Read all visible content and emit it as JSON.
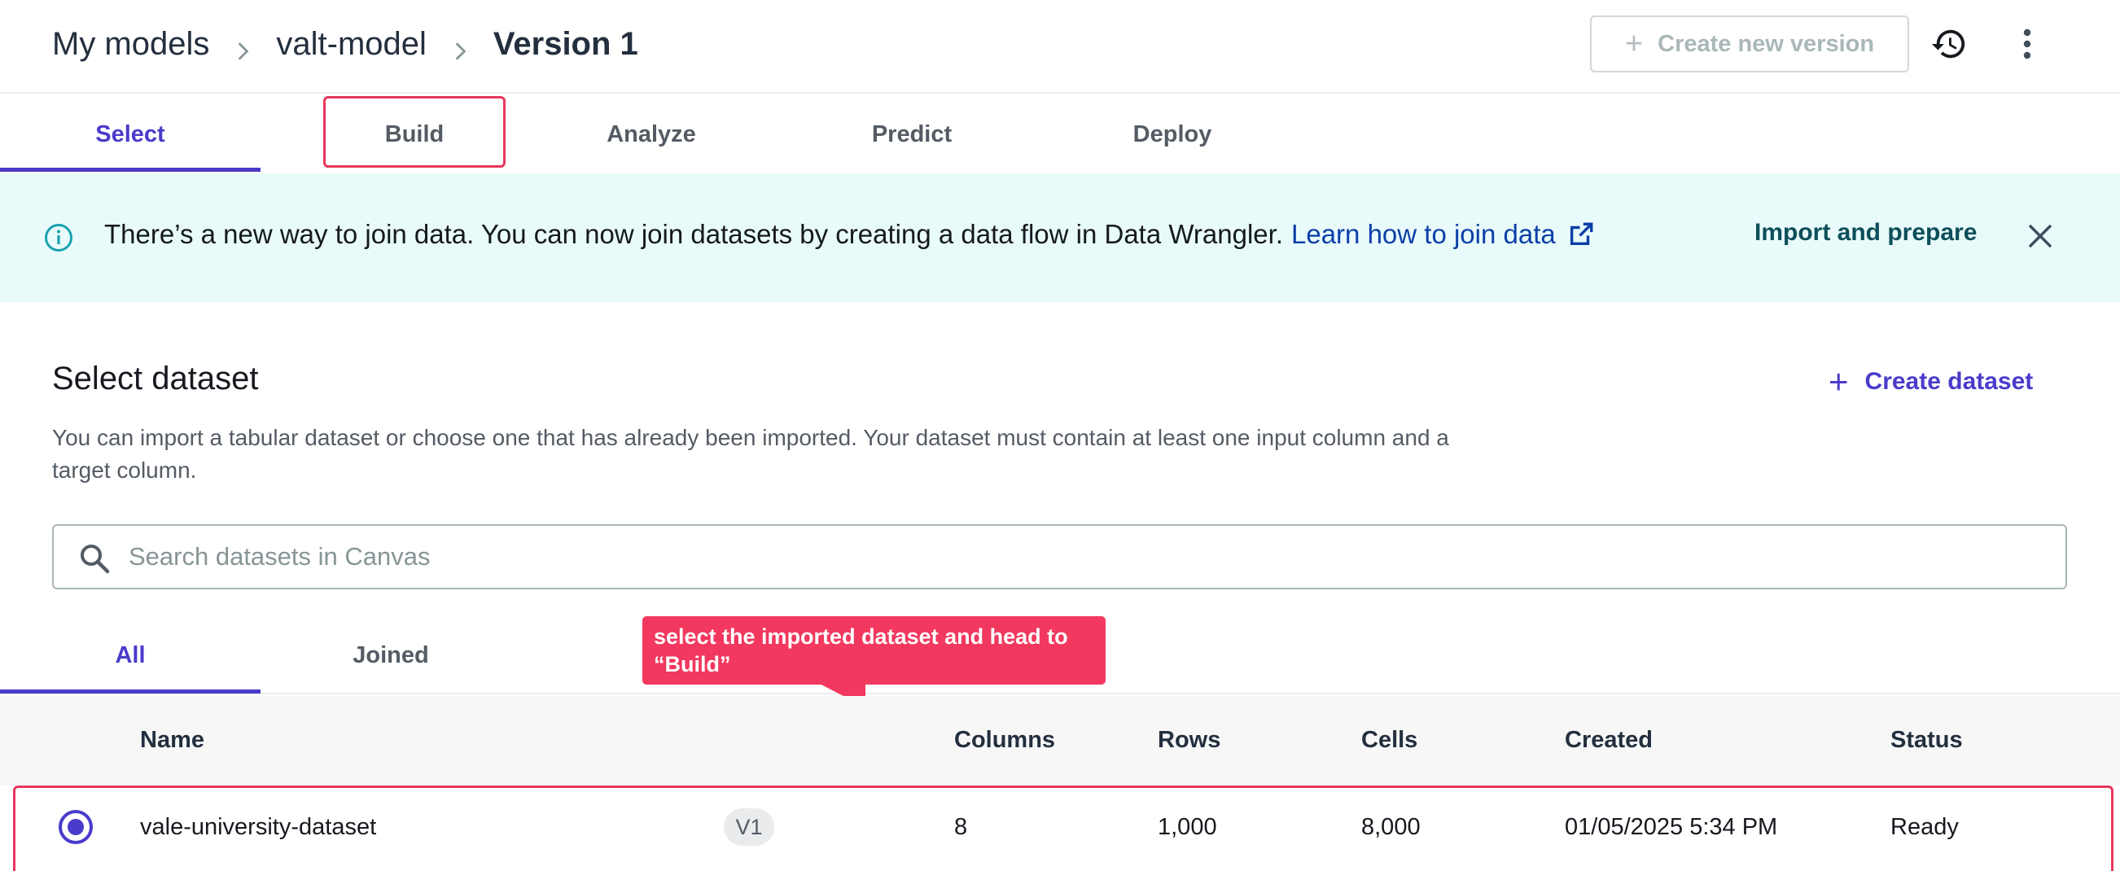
{
  "breadcrumb": {
    "items": [
      "My models",
      "valt-model"
    ],
    "current": "Version 1"
  },
  "header": {
    "create_version_label": "Create new version",
    "history_icon": "history-icon",
    "more_icon": "more-vertical-icon"
  },
  "tabs": [
    {
      "label": "Select",
      "active": true
    },
    {
      "label": "Build",
      "active": false
    },
    {
      "label": "Analyze",
      "active": false
    },
    {
      "label": "Predict",
      "active": false
    },
    {
      "label": "Deploy",
      "active": false
    }
  ],
  "banner": {
    "text": "There’s a new way to join data. You can now join datasets by creating a data flow in Data Wrangler.",
    "link_text": "Learn how to join data",
    "action_label": "Import and prepare",
    "background_color": "#e8fbfa"
  },
  "select_dataset": {
    "title": "Select dataset",
    "create_label": "Create dataset",
    "description": "You can import a tabular dataset or choose one that has already been imported. Your dataset must contain at least one input column and a target column.",
    "search_placeholder": "Search datasets in Canvas",
    "search_value": ""
  },
  "subtabs": [
    {
      "label": "All",
      "active": true
    },
    {
      "label": "Joined",
      "active": false
    }
  ],
  "callout": {
    "text": "select the imported dataset and head to “Build”",
    "color": "#f2385e"
  },
  "table": {
    "headers": [
      "Name",
      "Columns",
      "Rows",
      "Cells",
      "Created",
      "Status"
    ],
    "rows": [
      {
        "selected": true,
        "name": "vale-university-dataset",
        "version": "V1",
        "columns": "8",
        "rows": "1,000",
        "cells": "8,000",
        "created": "01/05/2025 5:34 PM",
        "status": "Ready"
      }
    ]
  },
  "colors": {
    "accent": "#4a3bcb",
    "highlight": "#e8365d"
  }
}
